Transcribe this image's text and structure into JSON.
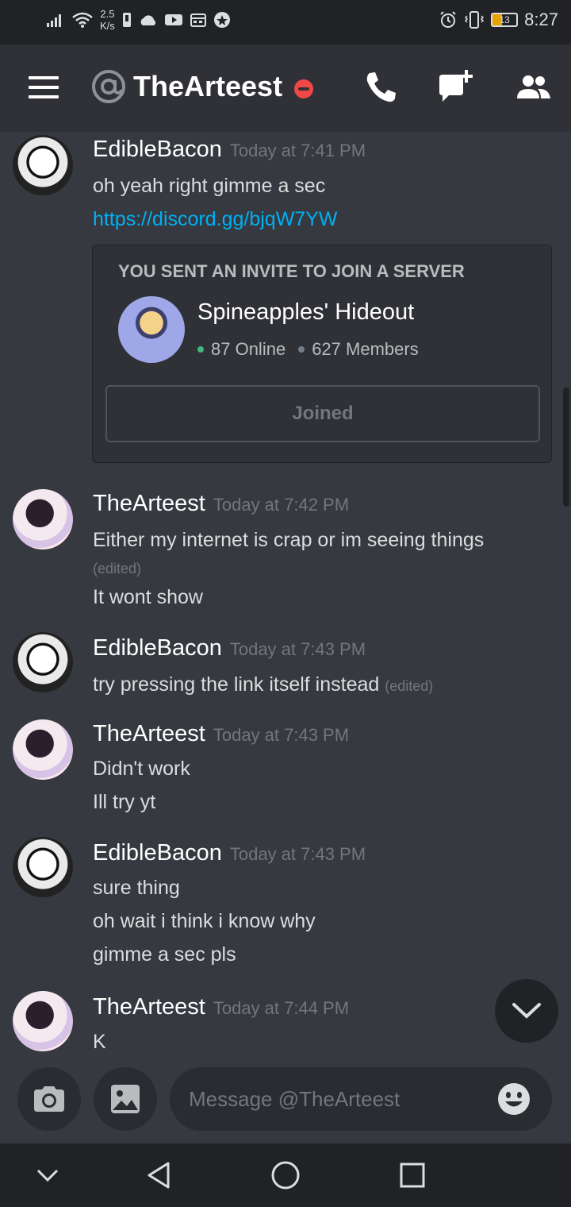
{
  "status_bar": {
    "speed_value": "2.5",
    "speed_unit": "K/s",
    "battery": "13",
    "time": "8:27",
    "icons": [
      "signal-icon",
      "wifi-icon",
      "notification-icon",
      "cloud-icon",
      "youtube-icon",
      "calendar-icon",
      "app-icon",
      "alarm-icon",
      "vibrate-icon",
      "battery-icon"
    ]
  },
  "header": {
    "title": "TheArteest",
    "status": "do-not-disturb",
    "icons": [
      "menu-icon",
      "at-icon",
      "phone-icon",
      "new-dm-icon",
      "members-icon"
    ]
  },
  "messages": [
    {
      "author": "EdibleBacon",
      "timestamp": "Today at 7:41 PM",
      "lines": [
        "oh yeah right gimme a sec"
      ],
      "link": "https://discord.gg/bjqW7YW",
      "invite": {
        "heading": "YOU SENT AN INVITE TO JOIN A SERVER",
        "server_name": "Spineapples' Hideout",
        "online": "87 Online",
        "members": "627 Members",
        "button_label": "Joined"
      }
    },
    {
      "author": "TheArteest",
      "timestamp": "Today at 7:42 PM",
      "lines": [
        "Either my internet is crap or im seeing things",
        "It wont show"
      ],
      "edited_label": "(edited)"
    },
    {
      "author": "EdibleBacon",
      "timestamp": "Today at 7:43 PM",
      "lines": [
        "try pressing the link itself instead"
      ],
      "edited_label": "(edited)"
    },
    {
      "author": "TheArteest",
      "timestamp": "Today at 7:43 PM",
      "lines": [
        "Didn't work",
        "Ill try yt"
      ]
    },
    {
      "author": "EdibleBacon",
      "timestamp": "Today at 7:43 PM",
      "lines": [
        "sure thing",
        "oh wait i think i know why",
        "gimme a sec pls"
      ]
    },
    {
      "author": "TheArteest",
      "timestamp": "Today at 7:44 PM",
      "lines": [
        "K"
      ]
    }
  ],
  "composer": {
    "placeholder": "Message @TheArteest",
    "value": ""
  },
  "colors": {
    "background": "#36393f",
    "header": "#2f3136",
    "link": "#00b0f4",
    "online": "#43b581",
    "dnd": "#f04747"
  }
}
